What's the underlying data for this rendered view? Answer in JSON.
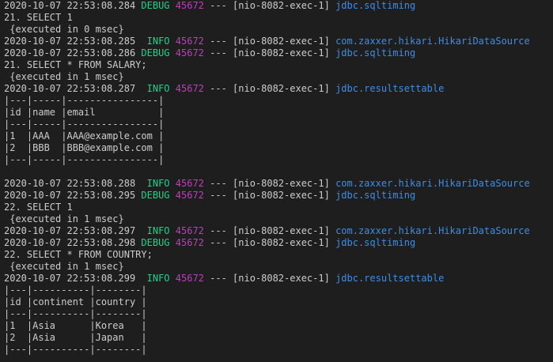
{
  "colors": {
    "background": "#1e1e1e",
    "text": "#cccccc",
    "level": "#23d18b",
    "pid": "#bc3fbc",
    "logger": "#3b8eea"
  },
  "lines": [
    {
      "type": "log",
      "ts": "2020-10-07 22:53:08.284",
      "level": "DEBUG",
      "pid": "45672",
      "thread": " --- [nio-8082-exec-1] ",
      "logger": "jdbc.sqltiming"
    },
    {
      "type": "text",
      "text": "21. SELECT 1"
    },
    {
      "type": "text",
      "text": " {executed in 0 msec}"
    },
    {
      "type": "log",
      "ts": "2020-10-07 22:53:08.285",
      "level": " INFO",
      "pid": "45672",
      "thread": " --- [nio-8082-exec-1] ",
      "logger": "com.zaxxer.hikari.HikariDataSource"
    },
    {
      "type": "log",
      "ts": "2020-10-07 22:53:08.286",
      "level": "DEBUG",
      "pid": "45672",
      "thread": " --- [nio-8082-exec-1] ",
      "logger": "jdbc.sqltiming"
    },
    {
      "type": "text",
      "text": "21. SELECT * FROM SALARY;"
    },
    {
      "type": "text",
      "text": " {executed in 1 msec}"
    },
    {
      "type": "log",
      "ts": "2020-10-07 22:53:08.287",
      "level": " INFO",
      "pid": "45672",
      "thread": " --- [nio-8082-exec-1] ",
      "logger": "jdbc.resultsettable"
    },
    {
      "type": "text",
      "text": "|---|-----|----------------|"
    },
    {
      "type": "text",
      "text": "|id |name |email           |"
    },
    {
      "type": "text",
      "text": "|---|-----|----------------|"
    },
    {
      "type": "text",
      "text": "|1  |AAA  |AAA@example.com |"
    },
    {
      "type": "text",
      "text": "|2  |BBB  |BBB@example.com |"
    },
    {
      "type": "text",
      "text": "|---|-----|----------------|"
    },
    {
      "type": "text",
      "text": ""
    },
    {
      "type": "log",
      "ts": "2020-10-07 22:53:08.288",
      "level": " INFO",
      "pid": "45672",
      "thread": " --- [nio-8082-exec-1] ",
      "logger": "com.zaxxer.hikari.HikariDataSource"
    },
    {
      "type": "log",
      "ts": "2020-10-07 22:53:08.295",
      "level": "DEBUG",
      "pid": "45672",
      "thread": " --- [nio-8082-exec-1] ",
      "logger": "jdbc.sqltiming"
    },
    {
      "type": "text",
      "text": "22. SELECT 1"
    },
    {
      "type": "text",
      "text": " {executed in 1 msec}"
    },
    {
      "type": "log",
      "ts": "2020-10-07 22:53:08.297",
      "level": " INFO",
      "pid": "45672",
      "thread": " --- [nio-8082-exec-1] ",
      "logger": "com.zaxxer.hikari.HikariDataSource"
    },
    {
      "type": "log",
      "ts": "2020-10-07 22:53:08.298",
      "level": "DEBUG",
      "pid": "45672",
      "thread": " --- [nio-8082-exec-1] ",
      "logger": "jdbc.sqltiming"
    },
    {
      "type": "text",
      "text": "22. SELECT * FROM COUNTRY;"
    },
    {
      "type": "text",
      "text": " {executed in 1 msec}"
    },
    {
      "type": "log",
      "ts": "2020-10-07 22:53:08.299",
      "level": " INFO",
      "pid": "45672",
      "thread": " --- [nio-8082-exec-1] ",
      "logger": "jdbc.resultsettable"
    },
    {
      "type": "text",
      "text": "|---|----------|--------|"
    },
    {
      "type": "text",
      "text": "|id |continent |country |"
    },
    {
      "type": "text",
      "text": "|---|----------|--------|"
    },
    {
      "type": "text",
      "text": "|1  |Asia      |Korea   |"
    },
    {
      "type": "text",
      "text": "|2  |Asia      |Japan   |"
    },
    {
      "type": "text",
      "text": "|---|----------|--------|"
    }
  ]
}
